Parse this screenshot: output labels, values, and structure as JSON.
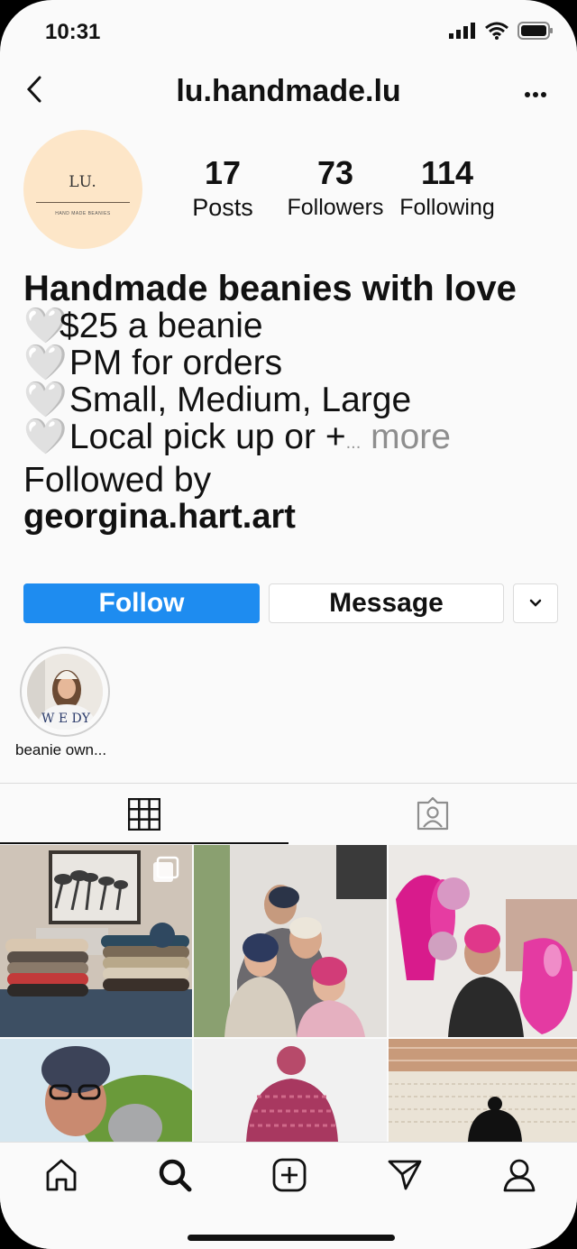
{
  "status_bar": {
    "time": "10:31"
  },
  "header": {
    "username": "lu.handmade.lu"
  },
  "profile": {
    "logo_text": "LU.",
    "logo_subtext": "HAND MADE BEANIES",
    "stats": [
      {
        "value": "17",
        "label": "Posts"
      },
      {
        "value": "73",
        "label": "Followers"
      },
      {
        "value": "114",
        "label": "Following"
      }
    ]
  },
  "bio": {
    "name": "Handmade beanies with love",
    "heart": "🤍",
    "lines": [
      "$25 a beanie",
      " PM for orders",
      " Small, Medium, Large",
      " Local pick up or +"
    ],
    "ellipsis": "...",
    "more": "more",
    "followed_by": "Followed by",
    "followed_by_user": "georgina.hart.art"
  },
  "actions": {
    "follow": "Follow",
    "message": "Message"
  },
  "highlights": [
    {
      "label": "beanie own..."
    }
  ],
  "tabs": [
    {
      "icon": "grid-icon"
    },
    {
      "icon": "tagged-icon"
    }
  ],
  "bottom_nav": [
    "home-icon",
    "search-icon",
    "new-post-icon",
    "direct-icon",
    "profile-icon"
  ]
}
